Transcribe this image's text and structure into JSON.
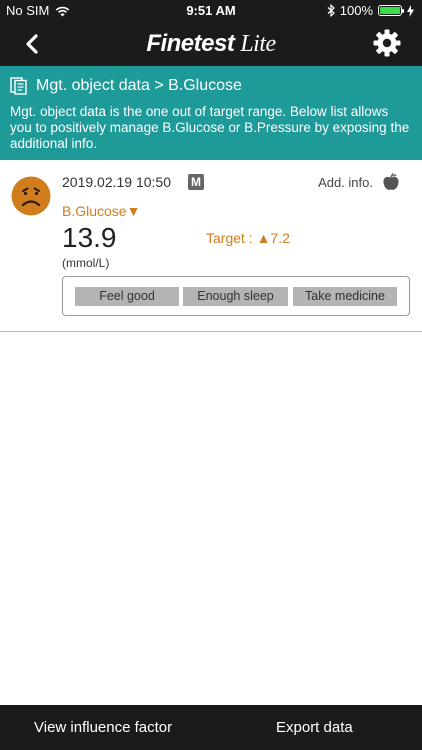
{
  "status_bar": {
    "carrier": "No SIM",
    "time": "9:51 AM",
    "battery_text": "100%",
    "battery_level": 1.0,
    "battery_color": "#3ddc4b"
  },
  "app": {
    "logo_main": "Finetest",
    "logo_sub": "Lite",
    "nav_icons": [
      "back-arrow-icon",
      "gear-icon"
    ]
  },
  "info_panel": {
    "title": "Mgt. object data > B.Glucose",
    "description": "Mgt. object data is the one out of target range. Below list allows you to positively manage B.Glucose or B.Pressure by exposing the additional info.",
    "background": "#1e9a99"
  },
  "record": {
    "datetime": "2019.02.19 10:50",
    "mode_badge": "M",
    "add_info_label": "Add. info.",
    "measure_type": "B.Glucose▼",
    "value": "13.9",
    "unit": "(mmol/L)",
    "target": "Target : ▲7.2",
    "accent_color": "#d17d1d",
    "mood": "sad-face-icon",
    "tags": [
      "Feel good",
      "Enough sleep",
      "Take medicine"
    ]
  },
  "bottom_bar": {
    "left_button": "View influence factor",
    "right_button": "Export data"
  }
}
